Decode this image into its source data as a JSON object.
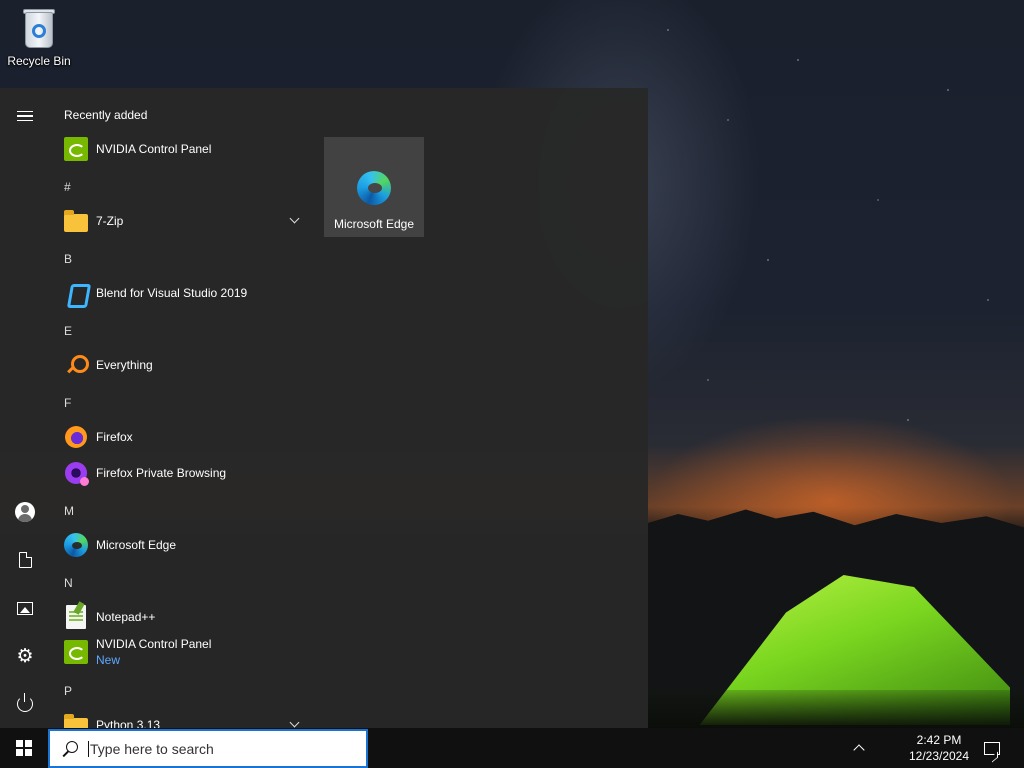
{
  "desktop": {
    "icons": [
      {
        "label": "Recycle Bin",
        "icon": "recycle-bin-icon"
      }
    ]
  },
  "start_menu": {
    "section_title": "Recently added",
    "apps": [
      {
        "name": "NVIDIA Control Panel",
        "icon": "nvidia-icon"
      },
      {
        "letter": "#"
      },
      {
        "name": "7-Zip",
        "icon": "folder-icon",
        "expandable": true
      },
      {
        "letter": "B"
      },
      {
        "name": "Blend for Visual Studio 2019",
        "icon": "blend-icon"
      },
      {
        "letter": "E"
      },
      {
        "name": "Everything",
        "icon": "magnifier-icon"
      },
      {
        "letter": "F"
      },
      {
        "name": "Firefox",
        "icon": "firefox-icon"
      },
      {
        "name": "Firefox Private Browsing",
        "icon": "firefox-private-icon"
      },
      {
        "letter": "M"
      },
      {
        "name": "Microsoft Edge",
        "icon": "edge-icon"
      },
      {
        "letter": "N"
      },
      {
        "name": "Notepad++",
        "icon": "notepad-plus-plus-icon"
      },
      {
        "name": "NVIDIA Control Panel",
        "icon": "nvidia-icon",
        "badge": "New"
      },
      {
        "letter": "P"
      },
      {
        "name": "Python 3.13",
        "icon": "folder-icon",
        "expandable": true
      }
    ],
    "tiles": [
      {
        "label": "Microsoft Edge",
        "icon": "edge-icon"
      }
    ],
    "rail": [
      "hamburger-icon",
      "user-icon",
      "documents-icon",
      "pictures-icon",
      "settings-icon",
      "power-icon"
    ]
  },
  "taskbar": {
    "search_placeholder": "Type here to search",
    "time": "2:42 PM",
    "date": "12/23/2024"
  }
}
